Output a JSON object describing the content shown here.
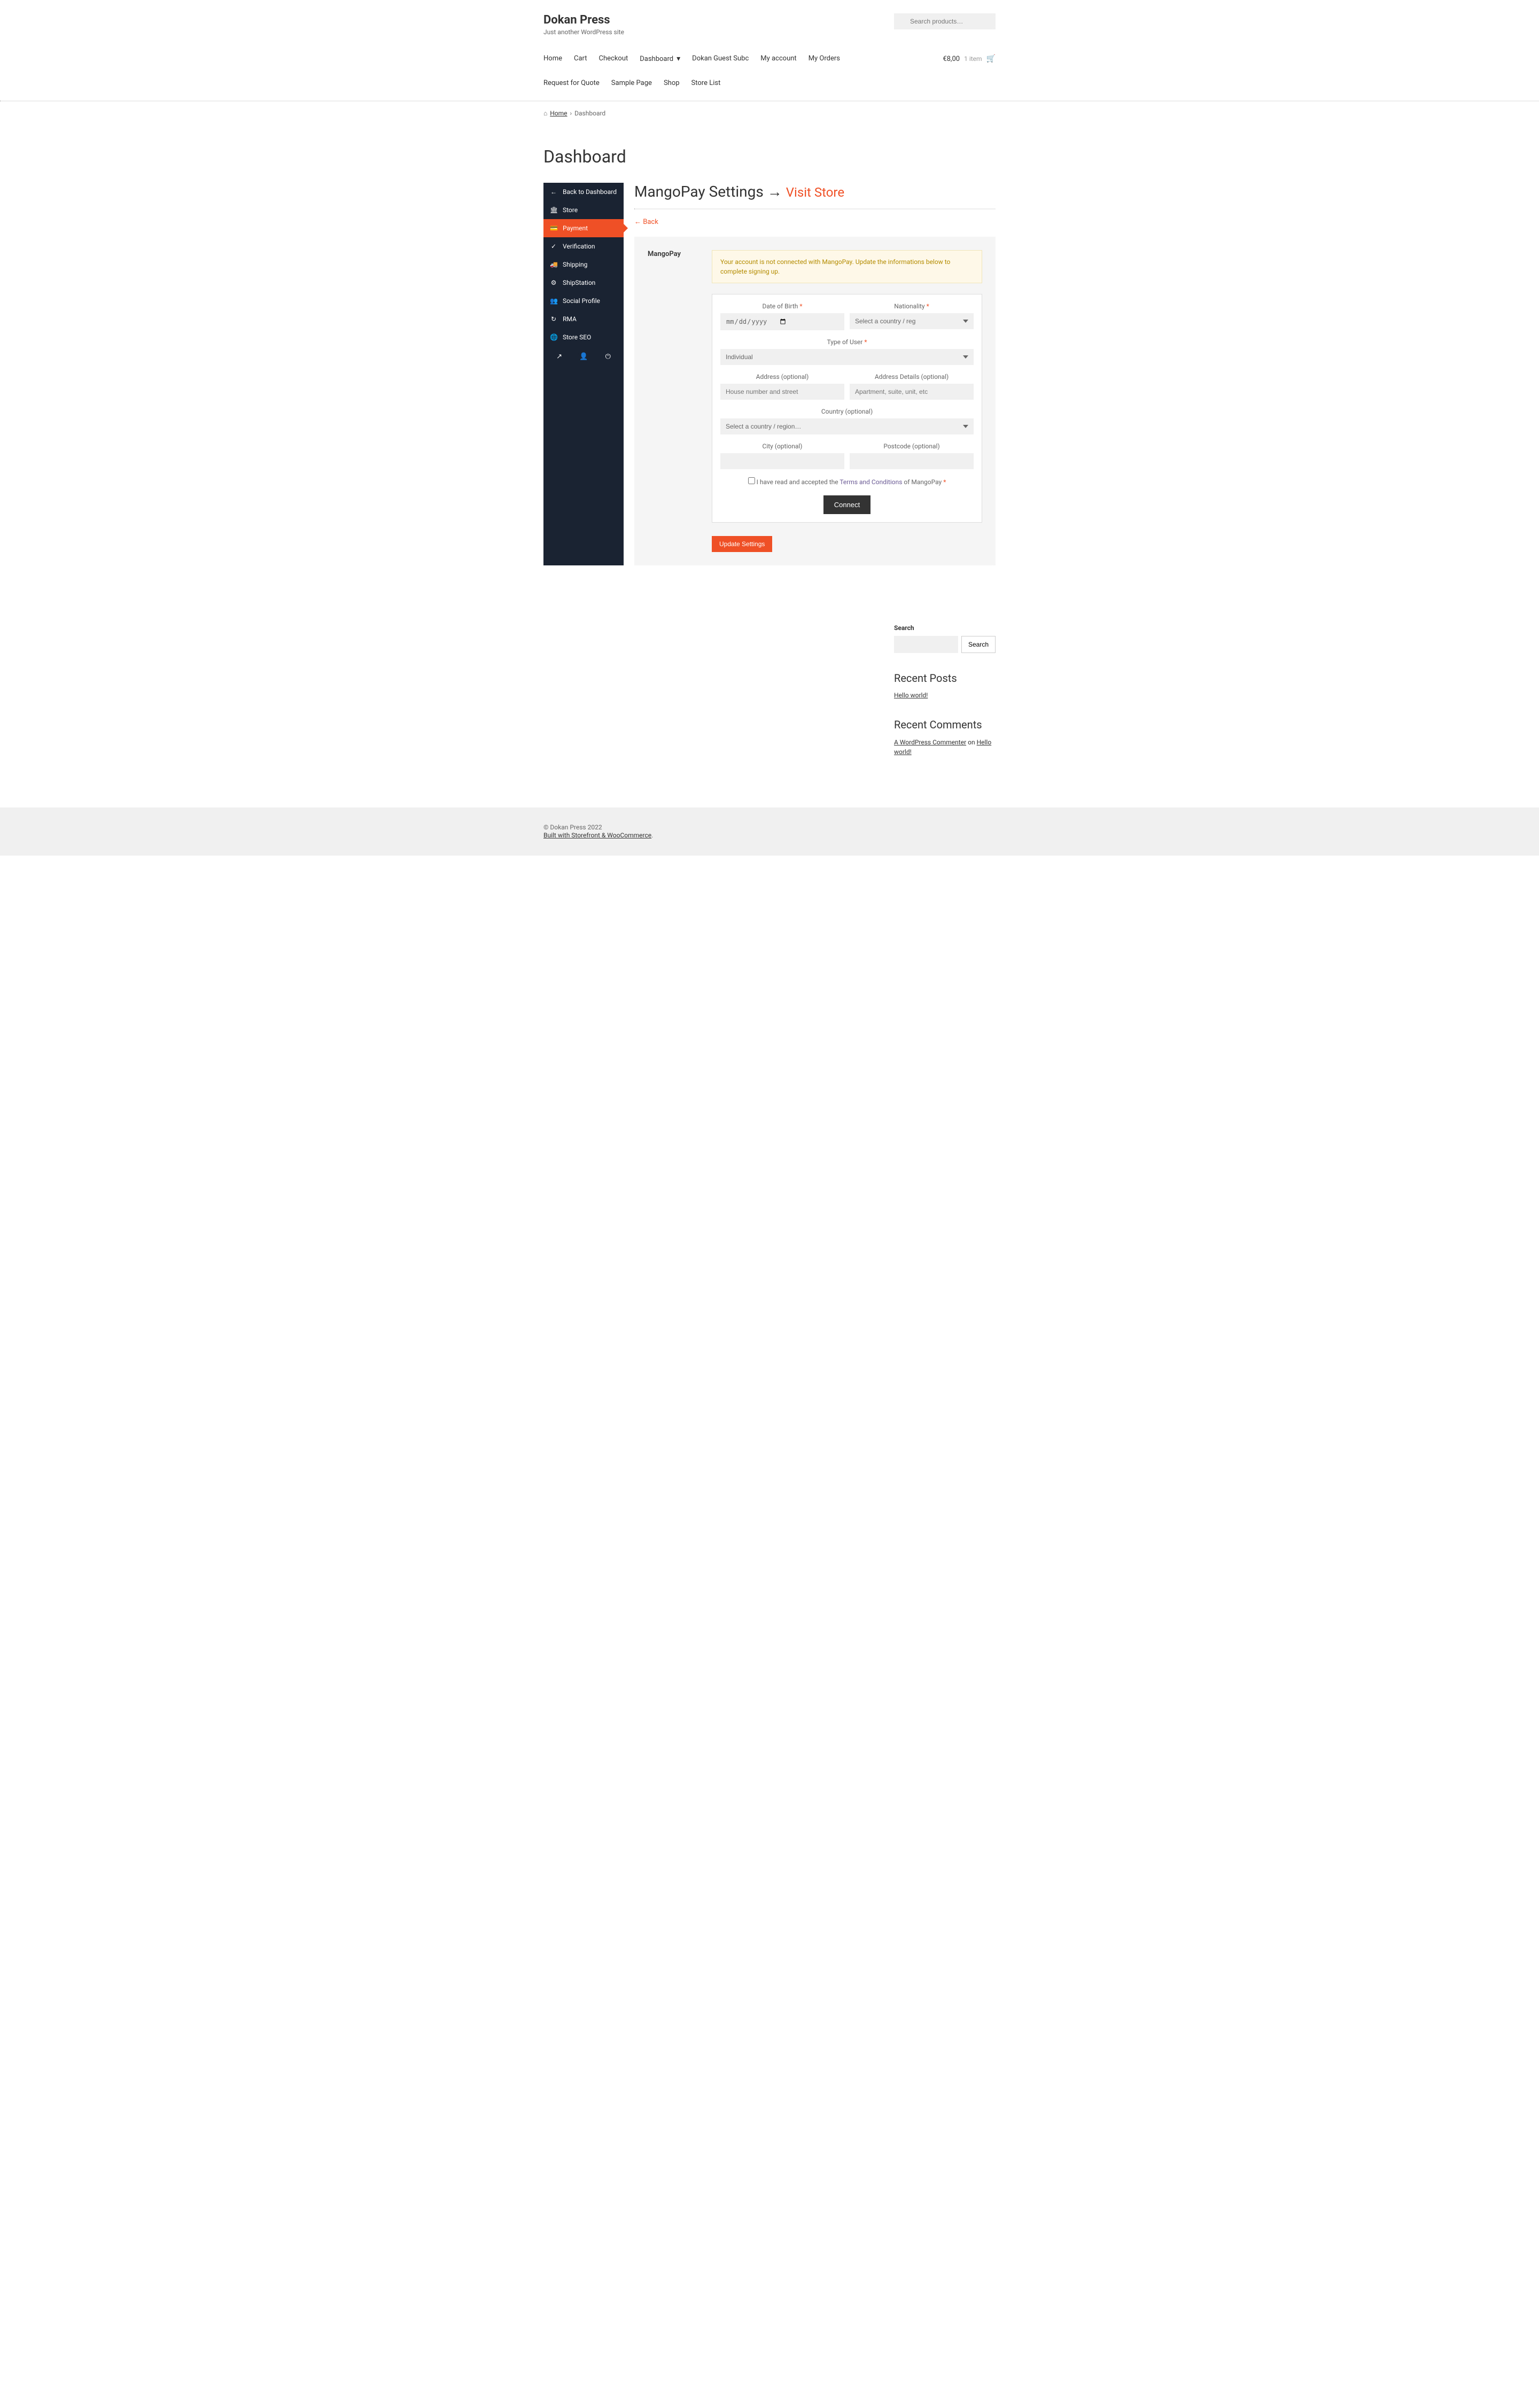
{
  "site": {
    "title": "Dokan Press",
    "tagline": "Just another WordPress site"
  },
  "search": {
    "placeholder": "Search products…"
  },
  "nav": {
    "row1": [
      "Home",
      "Cart",
      "Checkout",
      "Dashboard",
      "Dokan Guest Subc",
      "My account",
      "My Orders"
    ],
    "row2": [
      "Request for Quote",
      "Sample Page",
      "Shop",
      "Store List"
    ]
  },
  "cart": {
    "total": "€8,00",
    "count": "1 item"
  },
  "breadcrumb": {
    "home": "Home",
    "current": "Dashboard"
  },
  "page": {
    "title": "Dashboard"
  },
  "sidebar": {
    "items": [
      {
        "label": "Back to Dashboard",
        "icon": "←"
      },
      {
        "label": "Store",
        "icon": "🏛"
      },
      {
        "label": "Payment",
        "icon": "💳",
        "active": true
      },
      {
        "label": "Verification",
        "icon": "✓"
      },
      {
        "label": "Shipping",
        "icon": "🚚"
      },
      {
        "label": "ShipStation",
        "icon": "⚙"
      },
      {
        "label": "Social Profile",
        "icon": "👥"
      },
      {
        "label": "RMA",
        "icon": "↻"
      },
      {
        "label": "Store SEO",
        "icon": "🌐"
      }
    ]
  },
  "content": {
    "title": "MangoPay Settings",
    "arrow": "→",
    "visit_store": "Visit Store",
    "back": "← Back"
  },
  "settings": {
    "label": "MangoPay",
    "alert": "Your account is not connected with MangoPay. Update the informations below to complete signing up.",
    "form": {
      "dob_label": "Date of Birth",
      "dob_placeholder": "mm/dd/yyyy",
      "nationality_label": "Nationality",
      "nationality_placeholder": "Select a country / reg",
      "type_label": "Type of User",
      "type_value": "Individual",
      "address_label": "Address (optional)",
      "address_placeholder": "House number and street",
      "address_details_label": "Address Details (optional)",
      "address_details_placeholder": "Apartment, suite, unit, etc",
      "country_label": "Country (optional)",
      "country_placeholder": "Select a country / region…",
      "city_label": "City (optional)",
      "postcode_label": "Postcode (optional)",
      "terms_prefix": "I have read and accepted the ",
      "terms_link": "Terms and Conditions",
      "terms_suffix": " of MangoPay ",
      "connect": "Connect"
    },
    "update": "Update Settings"
  },
  "widgets": {
    "search_title": "Search",
    "search_btn": "Search",
    "recent_posts_title": "Recent Posts",
    "recent_post": "Hello world!",
    "recent_comments_title": "Recent Comments",
    "commenter": "A WordPress Commenter",
    "on": " on ",
    "comment_post": "Hello world!"
  },
  "footer": {
    "copyright": "© Dokan Press 2022",
    "built": "Built with Storefront & WooCommerce"
  }
}
